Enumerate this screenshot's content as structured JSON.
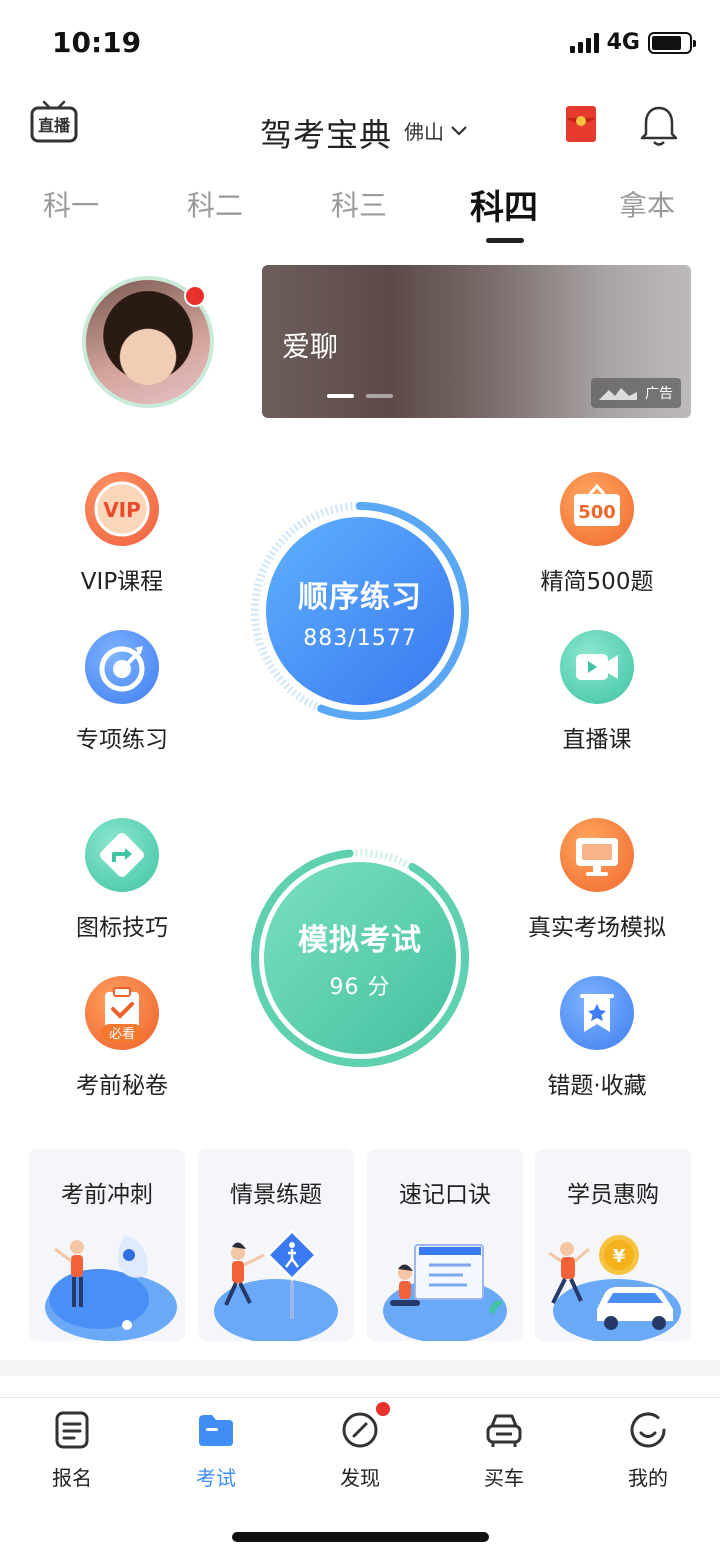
{
  "status": {
    "time": "10:19",
    "network": "4G"
  },
  "header": {
    "live_label": "直播",
    "title": "驾考宝典",
    "city": "佛山",
    "icons": [
      "live-tv-icon",
      "red-envelope-icon",
      "bell-icon"
    ]
  },
  "tabs": [
    {
      "label": "科一"
    },
    {
      "label": "科二"
    },
    {
      "label": "科三"
    },
    {
      "label": "科四",
      "active": true
    },
    {
      "label": "拿本"
    }
  ],
  "banner": {
    "text": "爱聊",
    "ad_label": "广告"
  },
  "features": {
    "vip": "VIP课程",
    "vip_badge": "VIP",
    "special": "专项练习",
    "sign": "图标技巧",
    "secret": "考前秘卷",
    "secret_badge": "必看",
    "q500": "精简500题",
    "q500_badge": "500",
    "live": "直播课",
    "real": "真实考场模拟",
    "wrong": "错题·收藏"
  },
  "practice": {
    "title": "顺序练习",
    "progress": "883/1577",
    "done": 883,
    "total": 1577
  },
  "exam": {
    "title": "模拟考试",
    "score": "96 分"
  },
  "cards": [
    {
      "title": "考前冲刺"
    },
    {
      "title": "情景练题"
    },
    {
      "title": "速记口诀"
    },
    {
      "title": "学员惠购"
    }
  ],
  "yen_symbol": "¥",
  "nav": [
    {
      "label": "报名"
    },
    {
      "label": "考试",
      "active": true
    },
    {
      "label": "发现"
    },
    {
      "label": "买车"
    },
    {
      "label": "我的"
    }
  ],
  "colors": {
    "blue": "#4a8ff5",
    "green": "#5fd0b0",
    "orange": "#f4792f",
    "red_dot": "#e8312a",
    "nav_active": "#3f8df5"
  }
}
